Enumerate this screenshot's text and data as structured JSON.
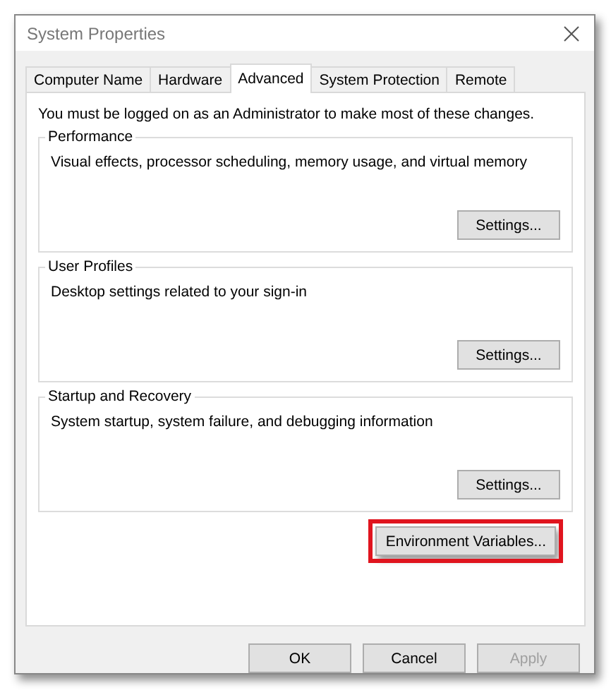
{
  "window": {
    "title": "System Properties"
  },
  "tabs": [
    {
      "label": "Computer Name",
      "selected": false
    },
    {
      "label": "Hardware",
      "selected": false
    },
    {
      "label": "Advanced",
      "selected": true
    },
    {
      "label": "System Protection",
      "selected": false
    },
    {
      "label": "Remote",
      "selected": false
    }
  ],
  "notice": "You must be logged on as an Administrator to make most of these changes.",
  "groups": [
    {
      "title": "Performance",
      "description": "Visual effects, processor scheduling, memory usage, and virtual memory",
      "button": "Settings..."
    },
    {
      "title": "User Profiles",
      "description": "Desktop settings related to your sign-in",
      "button": "Settings..."
    },
    {
      "title": "Startup and Recovery",
      "description": "System startup, system failure, and debugging information",
      "button": "Settings..."
    }
  ],
  "environment_button": {
    "label": "Environment Variables...",
    "highlighted": true
  },
  "buttons": [
    {
      "label": "OK",
      "disabled": false
    },
    {
      "label": "Cancel",
      "disabled": false
    },
    {
      "label": "Apply",
      "disabled": true
    }
  ]
}
